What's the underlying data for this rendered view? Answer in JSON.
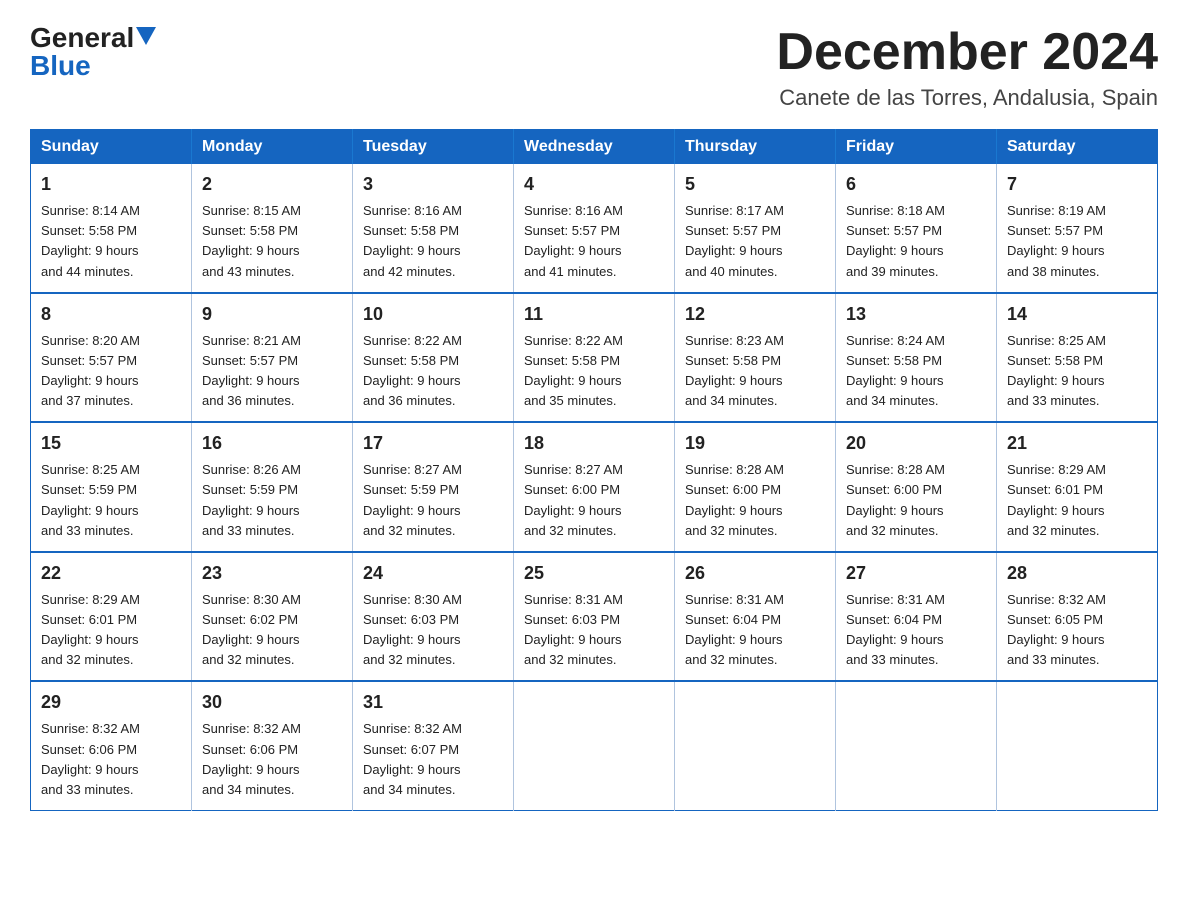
{
  "logo": {
    "part1": "General",
    "part2": "Blue"
  },
  "title": "December 2024",
  "subtitle": "Canete de las Torres, Andalusia, Spain",
  "days_of_week": [
    "Sunday",
    "Monday",
    "Tuesday",
    "Wednesday",
    "Thursday",
    "Friday",
    "Saturday"
  ],
  "weeks": [
    [
      {
        "day": "1",
        "sunrise": "8:14 AM",
        "sunset": "5:58 PM",
        "daylight": "9 hours and 44 minutes."
      },
      {
        "day": "2",
        "sunrise": "8:15 AM",
        "sunset": "5:58 PM",
        "daylight": "9 hours and 43 minutes."
      },
      {
        "day": "3",
        "sunrise": "8:16 AM",
        "sunset": "5:58 PM",
        "daylight": "9 hours and 42 minutes."
      },
      {
        "day": "4",
        "sunrise": "8:16 AM",
        "sunset": "5:57 PM",
        "daylight": "9 hours and 41 minutes."
      },
      {
        "day": "5",
        "sunrise": "8:17 AM",
        "sunset": "5:57 PM",
        "daylight": "9 hours and 40 minutes."
      },
      {
        "day": "6",
        "sunrise": "8:18 AM",
        "sunset": "5:57 PM",
        "daylight": "9 hours and 39 minutes."
      },
      {
        "day": "7",
        "sunrise": "8:19 AM",
        "sunset": "5:57 PM",
        "daylight": "9 hours and 38 minutes."
      }
    ],
    [
      {
        "day": "8",
        "sunrise": "8:20 AM",
        "sunset": "5:57 PM",
        "daylight": "9 hours and 37 minutes."
      },
      {
        "day": "9",
        "sunrise": "8:21 AM",
        "sunset": "5:57 PM",
        "daylight": "9 hours and 36 minutes."
      },
      {
        "day": "10",
        "sunrise": "8:22 AM",
        "sunset": "5:58 PM",
        "daylight": "9 hours and 36 minutes."
      },
      {
        "day": "11",
        "sunrise": "8:22 AM",
        "sunset": "5:58 PM",
        "daylight": "9 hours and 35 minutes."
      },
      {
        "day": "12",
        "sunrise": "8:23 AM",
        "sunset": "5:58 PM",
        "daylight": "9 hours and 34 minutes."
      },
      {
        "day": "13",
        "sunrise": "8:24 AM",
        "sunset": "5:58 PM",
        "daylight": "9 hours and 34 minutes."
      },
      {
        "day": "14",
        "sunrise": "8:25 AM",
        "sunset": "5:58 PM",
        "daylight": "9 hours and 33 minutes."
      }
    ],
    [
      {
        "day": "15",
        "sunrise": "8:25 AM",
        "sunset": "5:59 PM",
        "daylight": "9 hours and 33 minutes."
      },
      {
        "day": "16",
        "sunrise": "8:26 AM",
        "sunset": "5:59 PM",
        "daylight": "9 hours and 33 minutes."
      },
      {
        "day": "17",
        "sunrise": "8:27 AM",
        "sunset": "5:59 PM",
        "daylight": "9 hours and 32 minutes."
      },
      {
        "day": "18",
        "sunrise": "8:27 AM",
        "sunset": "6:00 PM",
        "daylight": "9 hours and 32 minutes."
      },
      {
        "day": "19",
        "sunrise": "8:28 AM",
        "sunset": "6:00 PM",
        "daylight": "9 hours and 32 minutes."
      },
      {
        "day": "20",
        "sunrise": "8:28 AM",
        "sunset": "6:00 PM",
        "daylight": "9 hours and 32 minutes."
      },
      {
        "day": "21",
        "sunrise": "8:29 AM",
        "sunset": "6:01 PM",
        "daylight": "9 hours and 32 minutes."
      }
    ],
    [
      {
        "day": "22",
        "sunrise": "8:29 AM",
        "sunset": "6:01 PM",
        "daylight": "9 hours and 32 minutes."
      },
      {
        "day": "23",
        "sunrise": "8:30 AM",
        "sunset": "6:02 PM",
        "daylight": "9 hours and 32 minutes."
      },
      {
        "day": "24",
        "sunrise": "8:30 AM",
        "sunset": "6:03 PM",
        "daylight": "9 hours and 32 minutes."
      },
      {
        "day": "25",
        "sunrise": "8:31 AM",
        "sunset": "6:03 PM",
        "daylight": "9 hours and 32 minutes."
      },
      {
        "day": "26",
        "sunrise": "8:31 AM",
        "sunset": "6:04 PM",
        "daylight": "9 hours and 32 minutes."
      },
      {
        "day": "27",
        "sunrise": "8:31 AM",
        "sunset": "6:04 PM",
        "daylight": "9 hours and 33 minutes."
      },
      {
        "day": "28",
        "sunrise": "8:32 AM",
        "sunset": "6:05 PM",
        "daylight": "9 hours and 33 minutes."
      }
    ],
    [
      {
        "day": "29",
        "sunrise": "8:32 AM",
        "sunset": "6:06 PM",
        "daylight": "9 hours and 33 minutes."
      },
      {
        "day": "30",
        "sunrise": "8:32 AM",
        "sunset": "6:06 PM",
        "daylight": "9 hours and 34 minutes."
      },
      {
        "day": "31",
        "sunrise": "8:32 AM",
        "sunset": "6:07 PM",
        "daylight": "9 hours and 34 minutes."
      },
      null,
      null,
      null,
      null
    ]
  ],
  "labels": {
    "sunrise": "Sunrise:",
    "sunset": "Sunset:",
    "daylight": "Daylight:"
  }
}
